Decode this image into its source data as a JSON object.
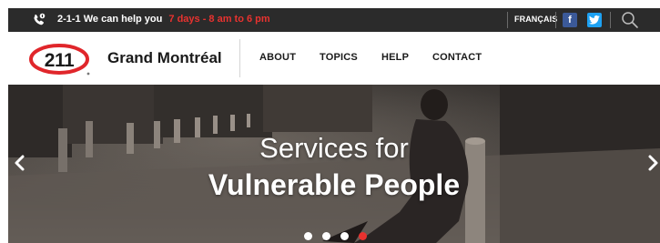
{
  "topbar": {
    "help_label": "2-1-1 We can help you",
    "hours": "7 days - 8 am to 6 pm",
    "language_link": "FRANÇAIS",
    "social": [
      {
        "icon": "facebook-icon",
        "glyph": "f"
      },
      {
        "icon": "twitter-icon"
      }
    ]
  },
  "nav": {
    "logo_text": "211",
    "brand": "Grand Montréal",
    "items": [
      {
        "label": "ABOUT"
      },
      {
        "label": "TOPICS"
      },
      {
        "label": "HELP"
      },
      {
        "label": "CONTACT"
      }
    ]
  },
  "hero": {
    "title_line1": "Services for",
    "title_line2": "Vulnerable People",
    "slides_total": 4,
    "active_slide": 4
  },
  "colors": {
    "accent_red": "#e8322f",
    "topbar_bg": "#2b2b2b",
    "facebook": "#3b5998",
    "twitter": "#1da1f2"
  }
}
